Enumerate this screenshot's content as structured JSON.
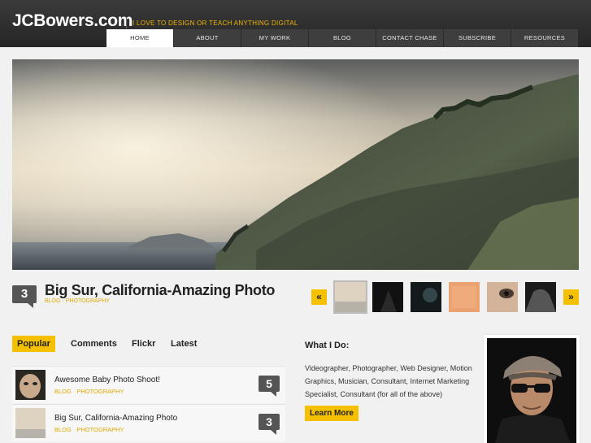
{
  "site": {
    "logo": "JCBowers.com",
    "tagline": "I LOVE TO DESIGN OR TEACH ANYTHING DIGITAL"
  },
  "nav": [
    {
      "label": "HOME",
      "active": true
    },
    {
      "label": "ABOUT"
    },
    {
      "label": "MY WORK"
    },
    {
      "label": "BLOG"
    },
    {
      "label": "CONTACT CHASE"
    },
    {
      "label": "SUBSCRIBE"
    },
    {
      "label": "RESOURCES"
    }
  ],
  "featured": {
    "count": "3",
    "title": "Big Sur, California-Amazing Photo",
    "tag1": "BLOG",
    "tag2": "PHOTOGRAPHY",
    "prev_label": "«",
    "next_label": "»"
  },
  "tabs": {
    "popular": "Popular",
    "comments": "Comments",
    "flickr": "Flickr",
    "latest": "Latest"
  },
  "posts": [
    {
      "title": "Awesome Baby Photo Shoot!",
      "tag1": "BLOG",
      "tag2": "PHOTOGRAPHY",
      "count": "5"
    },
    {
      "title": "Big Sur, California-Amazing Photo",
      "tag1": "BLOG",
      "tag2": "PHOTOGRAPHY",
      "count": "3"
    }
  ],
  "what_i_do": {
    "heading": "What I Do:",
    "body": "Videographer, Photographer, Web Designer, Motion Graphics, Musician, Consultant, Internet Marketing Specialist, Consultant (for all of the above)",
    "button": "Learn More"
  },
  "colors": {
    "accent": "#f5c000",
    "header_bg": "#2e2e2e",
    "badge": "#555555"
  }
}
